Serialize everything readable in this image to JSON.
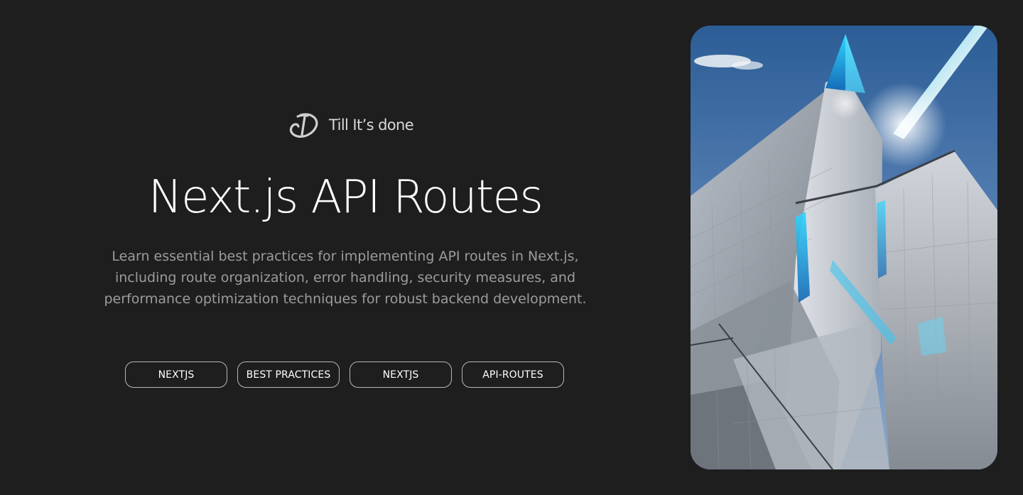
{
  "brand": {
    "name": "Till It’s done",
    "logo_icon": "brand-logo-icon"
  },
  "post": {
    "title": "Next.js API Routes",
    "description_lines": [
      "Learn essential best practices for implementing API routes in Next.js,",
      "including route organization, error handling, security measures, and",
      "performance optimization techniques for robust backend development."
    ],
    "tags": [
      "NEXTJS",
      "BEST PRACTICES",
      "NEXTJS",
      "API-ROUTES"
    ]
  },
  "hero_image": {
    "subject": "architectural-building-image"
  },
  "colors": {
    "background": "#1e1e1f",
    "title": "#ffffff",
    "description": "#9c9c9c",
    "tag_border": "#b8b8b8"
  }
}
